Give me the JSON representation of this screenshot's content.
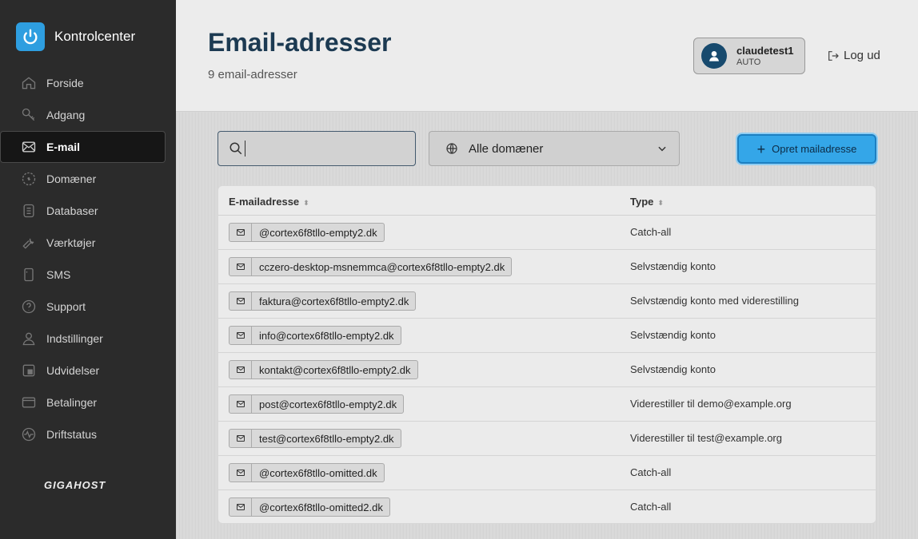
{
  "app": {
    "title": "Kontrolcenter",
    "footer_brand": "GIGAHOST",
    "accent_color": "#2e9ee0"
  },
  "sidebar": {
    "items": [
      {
        "label": "Forside",
        "icon": "home-icon",
        "active": false
      },
      {
        "label": "Adgang",
        "icon": "key-icon",
        "active": false
      },
      {
        "label": "E-mail",
        "icon": "mail-icon",
        "active": true
      },
      {
        "label": "Domæner",
        "icon": "domain-icon",
        "active": false
      },
      {
        "label": "Databaser",
        "icon": "database-icon",
        "active": false
      },
      {
        "label": "Værktøjer",
        "icon": "wrench-icon",
        "active": false
      },
      {
        "label": "SMS",
        "icon": "phone-icon",
        "active": false
      },
      {
        "label": "Support",
        "icon": "help-icon",
        "active": false
      },
      {
        "label": "Indstillinger",
        "icon": "user-icon",
        "active": false
      },
      {
        "label": "Udvidelser",
        "icon": "extension-icon",
        "active": false
      },
      {
        "label": "Betalinger",
        "icon": "card-icon",
        "active": false
      },
      {
        "label": "Driftstatus",
        "icon": "pulse-icon",
        "active": false
      }
    ]
  },
  "header": {
    "title": "Email-adresser",
    "subtitle": "9 email-adresser",
    "user": {
      "name": "claudetest1",
      "role": "AUTO"
    },
    "logout_label": "Log ud"
  },
  "toolbar": {
    "search_placeholder": "",
    "domain_filter": "Alle domæner",
    "create_label": "Opret mailadresse"
  },
  "table": {
    "columns": {
      "email": "E-mailadresse",
      "type": "Type"
    },
    "rows": [
      {
        "email": "@cortex6f8tllo-empty2.dk",
        "type": "Catch-all"
      },
      {
        "email": "cczero-desktop-msnemmca@cortex6f8tllo-empty2.dk",
        "type": "Selvstændig konto"
      },
      {
        "email": "faktura@cortex6f8tllo-empty2.dk",
        "type": "Selvstændig konto med viderestilling"
      },
      {
        "email": "info@cortex6f8tllo-empty2.dk",
        "type": "Selvstændig konto"
      },
      {
        "email": "kontakt@cortex6f8tllo-empty2.dk",
        "type": "Selvstændig konto"
      },
      {
        "email": "post@cortex6f8tllo-empty2.dk",
        "type": "Viderestiller til demo@example.org"
      },
      {
        "email": "test@cortex6f8tllo-empty2.dk",
        "type": "Viderestiller til test@example.org"
      },
      {
        "email": "@cortex6f8tllo-omitted.dk",
        "type": "Catch-all"
      },
      {
        "email": "@cortex6f8tllo-omitted2.dk",
        "type": "Catch-all"
      }
    ]
  }
}
